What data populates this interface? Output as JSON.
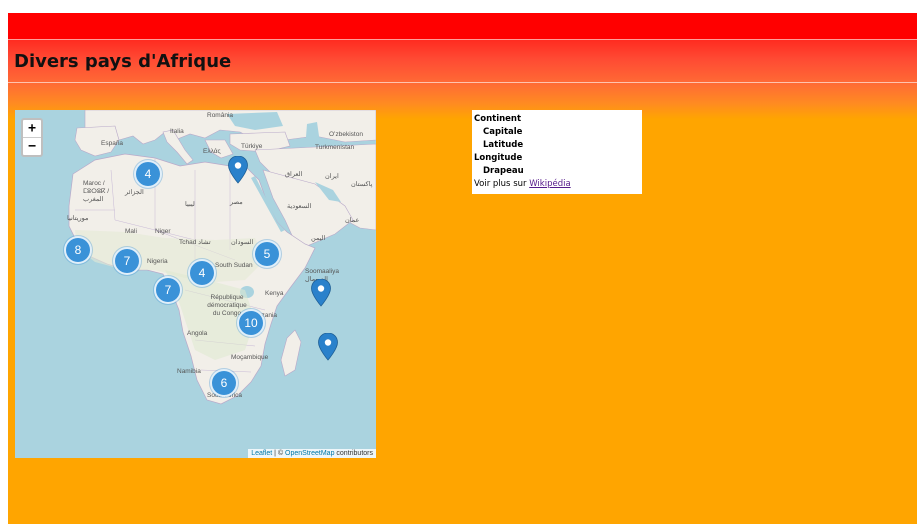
{
  "header": {
    "title": "Divers pays d'Afrique"
  },
  "map": {
    "zoom_in_label": "+",
    "zoom_out_label": "−",
    "clusters": [
      {
        "count": "4"
      },
      {
        "count": "8"
      },
      {
        "count": "7"
      },
      {
        "count": "4"
      },
      {
        "count": "5"
      },
      {
        "count": "7"
      },
      {
        "count": "10"
      },
      {
        "count": "6"
      }
    ],
    "labels": [
      "România",
      "Italia",
      "España",
      "Türkiye",
      "Ελλάς",
      "Oʻzbekiston",
      "Turkmenistan",
      "Maroc / ⵎⵓⵔⵓⴽ / المغرب",
      "الجزائر",
      "ليبيا",
      "مصر",
      "العراق",
      "ایران",
      "السعودية",
      "Mali",
      "Niger",
      "Tchad تشاد",
      "السودان",
      "Nigeria",
      "South Sudan",
      "Soomaaliya الصومال",
      "Kenya",
      "République démocratique du Congo",
      "Angola",
      "Tanzania",
      "Moçambique",
      "Namibia",
      "South Africa",
      "موريتانيا",
      "اليمن",
      "عمان",
      "پاکستان"
    ],
    "attribution": {
      "leaflet": "Leaflet",
      "separator": " | © ",
      "osm": "OpenStreetMap",
      "contributors": " contributors"
    }
  },
  "info": {
    "continent_label": "Continent",
    "capitale_label": "Capitale",
    "latitude_label": "Latitude",
    "longitude_label": "Longitude",
    "drapeau_label": "Drapeau",
    "more_prefix": "Voir plus sur ",
    "wikipedia_link": "Wikipédia"
  },
  "colors": {
    "red_bar": "#ff0000",
    "page_background": "#ffa500",
    "sea": "#aad3df",
    "land": "#f2efe9",
    "cluster": "#3a92d8",
    "marker": "#2a81cb"
  }
}
